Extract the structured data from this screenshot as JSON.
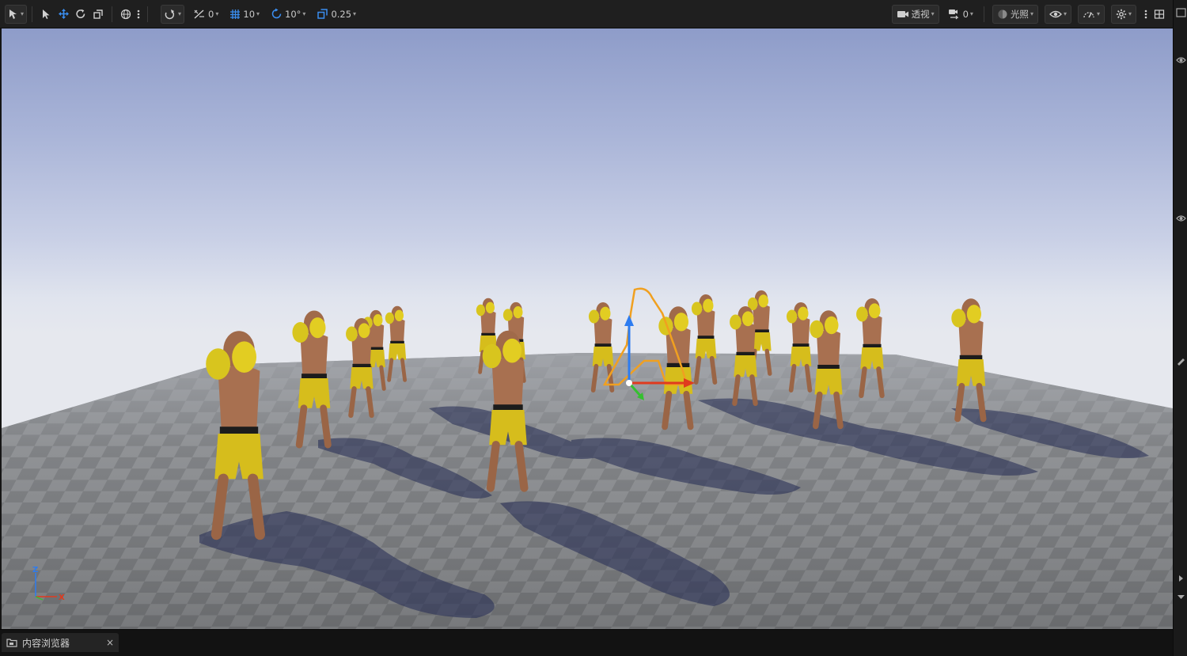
{
  "toolbar": {
    "surface_snap_value": "0",
    "grid_snap_value": "10",
    "rotation_snap_value": "10°",
    "scale_snap_value": "0.25",
    "view_mode_label": "透视",
    "camera_speed_value": "0",
    "lighting_label": "光照"
  },
  "viewport": {
    "axis_z_label": "Z",
    "axis_x_label": "X"
  },
  "bottom": {
    "content_browser_label": "内容浏览器",
    "close_label": "×"
  },
  "colors": {
    "toolbar_bg": "#1f1f1f",
    "accent_blue": "#3a8ef0",
    "selection_orange": "#f0a020",
    "boxer_yellow": "#d9c21e",
    "skin": "#a87050"
  }
}
